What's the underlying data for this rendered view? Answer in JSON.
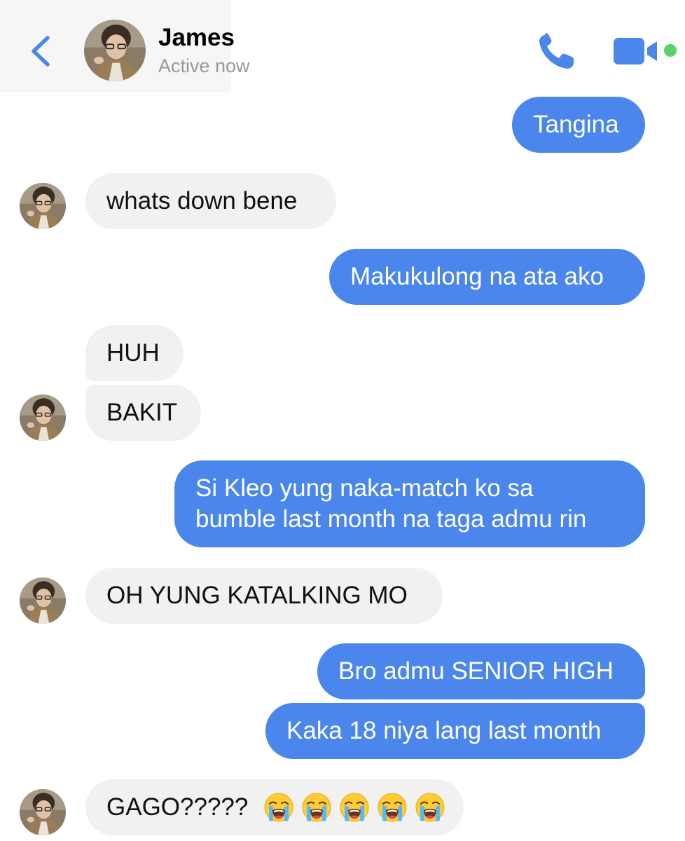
{
  "header": {
    "contact_name": "James",
    "status": "Active now",
    "accent_color": "#4a86ec",
    "online_color": "#5ad16b",
    "icons": [
      "chevron-left-icon",
      "phone-icon",
      "video-camera-icon"
    ]
  },
  "messages": [
    {
      "id": "m1",
      "direction": "outgoing",
      "text": "Tangina"
    },
    {
      "id": "m2",
      "direction": "incoming",
      "text": "whats down bene"
    },
    {
      "id": "m3",
      "direction": "outgoing",
      "text": "Makukulong na ata ako"
    },
    {
      "id": "m4",
      "direction": "incoming",
      "text": "HUH"
    },
    {
      "id": "m5",
      "direction": "incoming",
      "text": "BAKIT"
    },
    {
      "id": "m6",
      "direction": "outgoing",
      "lines": [
        "Si Kleo yung naka-match ko sa",
        "bumble last month na taga admu rin"
      ]
    },
    {
      "id": "m7",
      "direction": "incoming",
      "text": "OH YUNG KATALKING MO"
    },
    {
      "id": "m8",
      "direction": "outgoing",
      "text": "Bro admu SENIOR HIGH"
    },
    {
      "id": "m9",
      "direction": "outgoing",
      "text": "Kaka 18 niya lang last month"
    },
    {
      "id": "m10",
      "direction": "incoming",
      "text": "GAGO?????",
      "emoji": [
        "loudly-crying-face",
        "loudly-crying-face",
        "loudly-crying-face",
        "loudly-crying-face",
        "loudly-crying-face"
      ]
    }
  ]
}
